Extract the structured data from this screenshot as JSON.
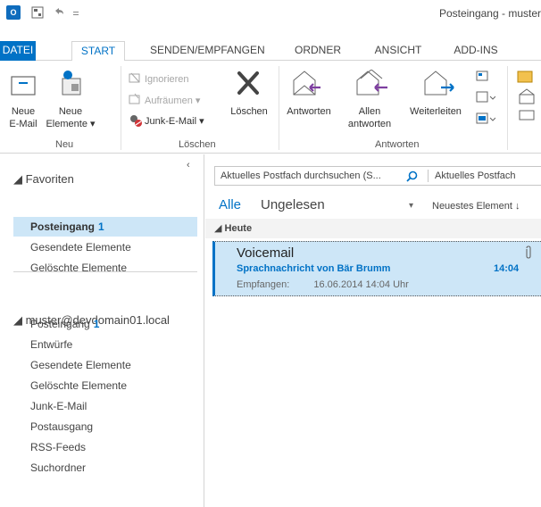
{
  "window": {
    "title": "Posteingang - muster"
  },
  "tabs": [
    "DATEI",
    "START",
    "SENDEN/EMPFANGEN",
    "ORDNER",
    "ANSICHT",
    "ADD-INS"
  ],
  "ribbon": {
    "neu": {
      "group_label": "Neu",
      "new_email": [
        "Neue",
        "E-Mail"
      ],
      "new_items": [
        "Neue",
        "Elemente"
      ]
    },
    "loeschen": {
      "group_label": "Löschen",
      "ignore": "Ignorieren",
      "cleanup": "Aufräumen",
      "junk": "Junk-E-Mail",
      "delete": "Löschen"
    },
    "antworten": {
      "group_label": "Antworten",
      "reply": "Antworten",
      "reply_all": [
        "Allen",
        "antworten"
      ],
      "forward": "Weiterleiten"
    }
  },
  "nav": {
    "favorites_header": "Favoriten",
    "favorites": [
      {
        "label": "Posteingang",
        "count": "1"
      },
      {
        "label": "Gesendete Elemente",
        "count": ""
      },
      {
        "label": "Gelöschte Elemente",
        "count": ""
      }
    ],
    "account_header": "muster@devdomain01.local",
    "account_items": [
      {
        "label": "Posteingang",
        "count": "1"
      },
      {
        "label": "Entwürfe",
        "count": ""
      },
      {
        "label": "Gesendete Elemente",
        "count": ""
      },
      {
        "label": "Gelöschte Elemente",
        "count": ""
      },
      {
        "label": "Junk-E-Mail",
        "count": ""
      },
      {
        "label": "Postausgang",
        "count": ""
      },
      {
        "label": "RSS-Feeds",
        "count": ""
      },
      {
        "label": "Suchordner",
        "count": ""
      }
    ]
  },
  "list": {
    "search_placeholder": "Aktuelles Postfach durchsuchen (S...",
    "search_scope": "Aktuelles Postfach",
    "filter_all": "Alle",
    "filter_unread": "Ungelesen",
    "sort_label": "Neuestes Element",
    "group_today": "Heute",
    "message": {
      "subject": "Voicemail",
      "preview": "Sprachnachricht von Bär Brumm",
      "time": "14:04",
      "received_label": "Empfangen:",
      "received_value": "16.06.2014 14:04 Uhr"
    }
  }
}
